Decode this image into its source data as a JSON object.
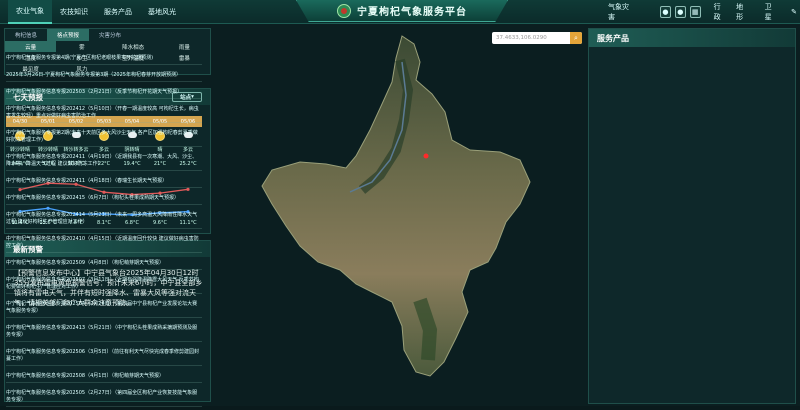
{
  "nav": {
    "left": [
      "农业气象",
      "农技知识",
      "服务产品",
      "基地风光"
    ],
    "title": "宁夏枸杞气象服务平台",
    "right": [
      "气象灾害",
      "行政",
      "地形",
      "卫星"
    ]
  },
  "search": {
    "placeholder": "37.4633,106.0290"
  },
  "left_panel": {
    "tabs": [
      "枸杞信息",
      "格点预报",
      "灾害分布"
    ],
    "grid": [
      "云量",
      "雾",
      "降水相态",
      "雨量",
      "湿度",
      "沙尘",
      "室外温度",
      "雷暴",
      "最见度",
      "风力"
    ]
  },
  "forecast": {
    "title": "七天预报",
    "station": "站点",
    "dates": [
      "04/30",
      "05/01",
      "05/02",
      "05/03",
      "05/04",
      "05/05",
      "05/06"
    ],
    "weather": [
      "转沙转晴",
      "转沙转晴",
      "转沙转多云",
      "多云",
      "阴转晴",
      "晴",
      "多云"
    ],
    "icons": [
      "sun",
      "sun",
      "cloud",
      "sun",
      "cloud",
      "sun",
      "cloud"
    ],
    "high_labels": [
      "24.9°C",
      "32°C",
      "30.8°C",
      "22°C",
      "19.4°C",
      "21°C",
      "25.2°C"
    ],
    "low_labels": [
      "11.4°C",
      "15.6°C",
      "7.8°C",
      "8.1°C",
      "6.8°C",
      "9.6°C",
      "11.1°C"
    ],
    "high": [
      24.9,
      32,
      30.8,
      22,
      19.4,
      21,
      25.2
    ],
    "low": [
      11.4,
      15.6,
      7.8,
      8.1,
      6.8,
      9.6,
      11.1
    ],
    "colors": {
      "high": "#e05a5a",
      "low": "#4aa3ff"
    }
  },
  "warning": {
    "title": "最新预警",
    "text": "【预警信息发布中心】中宁县气象台2025年04月30日12时35分发布雷电黄色预警信号：预计未来6小时，中宁县全部乡镇将有雷电天气，并伴有短时强降水、雷暴大风等强对流天气，请相关部门和广大群众注意预防。"
  },
  "products": {
    "title": "服务产品",
    "items": [
      "中宁枸杞气象服务专报第4期(宁夏产区枸杞老眼枝果实开花期预测)",
      "2025年3月26日-宁夏枸杞气象服务专报第3期（2025年枸杞春芽开放期预测）",
      "中宁枸杞气象服务信息专报202503（2月21日）（反季节枸杞开花期天气预报）",
      "中宁枸杞气象服务信息专报202412（5月10日）（开春一期温度较高 可枸杞生长，病虫害发生较轻）重点对做好病虫害防治工作",
      "中宁枸杞气象服务专报第2期(未来十天前区多大风沙尘天气 各产区加强枸杞春剪夏季做好防冻管理工作)",
      "中宁枸杞气象服务信息专报202411（4月19日）（近期我县有一次寒潮、大风、沙尘、降水等，降温天气过程 建议做好防冻工作）",
      "中宁枸杞气象服务信息专报202411（4月18日）（春瑞生长期天气预报）",
      "中宁枸杞气象服务信息专报202415（6月7日）（枸杞头茬果成熟期天气预报）",
      "中宁枸杞气象服务信息专报202414（5月23日）（未来一周多高温大风降雨性降水天气过程 建议好枸杞生产管理应对工作）",
      "中宁枸杞气象服务信息专报202410（4月15日）（近期温度回升较快 建议做好病虫害防控工作）",
      "中宁枸杞气象服务信息专报202509（4月8日）（枸杞萌芽期天气预报）",
      "中宁枸杞气象服务信息专报202507（3月11日）（近期有强降温降雪大风天气 反季节枸杞要做好枸杞生产管理应对工作）",
      "中宁枸杞气象服务信息专报202504（2月24日）（第四届中宁县枸杞产业发展论坛大赛气象服务专报）",
      "中宁枸杞气象服务信息专报202413（5月21日）（中宁枸杞头茬果成熟采摘期预测及服务专报）",
      "中宁枸杞气象服务信息专报202506（3月5日）（前往有利天气尽快完成春季修剪建园封蔓工作）",
      "中宁枸杞气象服务信息专报202508（4月1日）（枸杞萌芽期天气预报）",
      "中宁枸杞气象服务信息专报202505（2月27日）（第四届全区枸杞产业恢复技能气象服务专报）"
    ]
  }
}
